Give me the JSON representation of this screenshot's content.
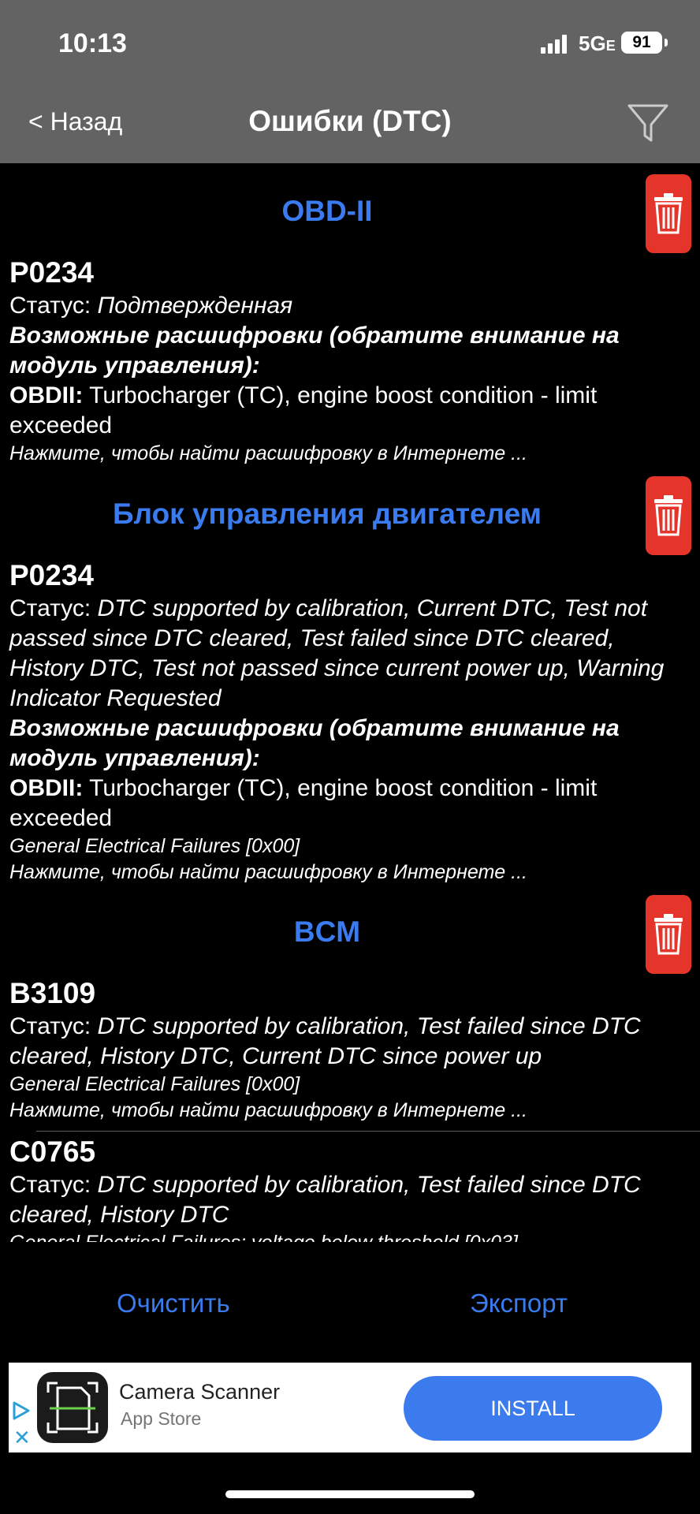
{
  "status_bar": {
    "time": "10:13",
    "network": "5G",
    "network_suffix": "E",
    "battery": "91"
  },
  "nav": {
    "back": "< Назад",
    "title": "Ошибки (DTC)"
  },
  "sections": [
    {
      "title": "OBD-II",
      "entries": [
        {
          "code": "P0234",
          "status_label": "Статус:",
          "status": "Подтвержденная",
          "decode_heading": "Возможные расшифровки (обратите внимание на модуль управления):",
          "obd_label": "OBDII:",
          "obd_text": "Turbocharger (TC), engine boost condition - limit exceeded",
          "search_hint": "Нажмите, чтобы найти расшифровку в Интернете ..."
        }
      ]
    },
    {
      "title": "Блок управления двигателем",
      "entries": [
        {
          "code": "P0234",
          "status_label": "Статус:",
          "status": "DTC supported by calibration, Current DTC, Test not passed since DTC cleared, Test failed since DTC cleared, History DTC, Test not passed since current power up, Warning Indicator Requested",
          "decode_heading": "Возможные расшифровки (обратите внимание на модуль управления):",
          "obd_label": "OBDII:",
          "obd_text": "Turbocharger (TC), engine boost condition - limit exceeded",
          "failure": "General Electrical Failures [0x00]",
          "search_hint": "Нажмите, чтобы найти расшифровку в Интернете ..."
        }
      ]
    },
    {
      "title": "BCM",
      "entries": [
        {
          "code": "B3109",
          "status_label": "Статус:",
          "status": "DTC supported by calibration, Test failed since DTC cleared, History DTC, Current DTC since power up",
          "failure": "General Electrical Failures [0x00]",
          "search_hint": "Нажмите, чтобы найти расшифровку в Интернете ..."
        },
        {
          "code": "C0765",
          "status_label": "Статус:",
          "status": "DTC supported by calibration, Test failed since DTC cleared, History DTC",
          "failure": "General Electrical Failures: voltage below threshold [0x03]"
        }
      ]
    }
  ],
  "actions": {
    "clear": "Очистить",
    "export": "Экспорт"
  },
  "ad": {
    "app_name": "Camera Scanner",
    "store": "App Store",
    "install": "INSTALL"
  },
  "colors": {
    "accent": "#3a7cf0",
    "delete": "#e5352b",
    "header_bg": "#636363",
    "background": "#000000"
  }
}
